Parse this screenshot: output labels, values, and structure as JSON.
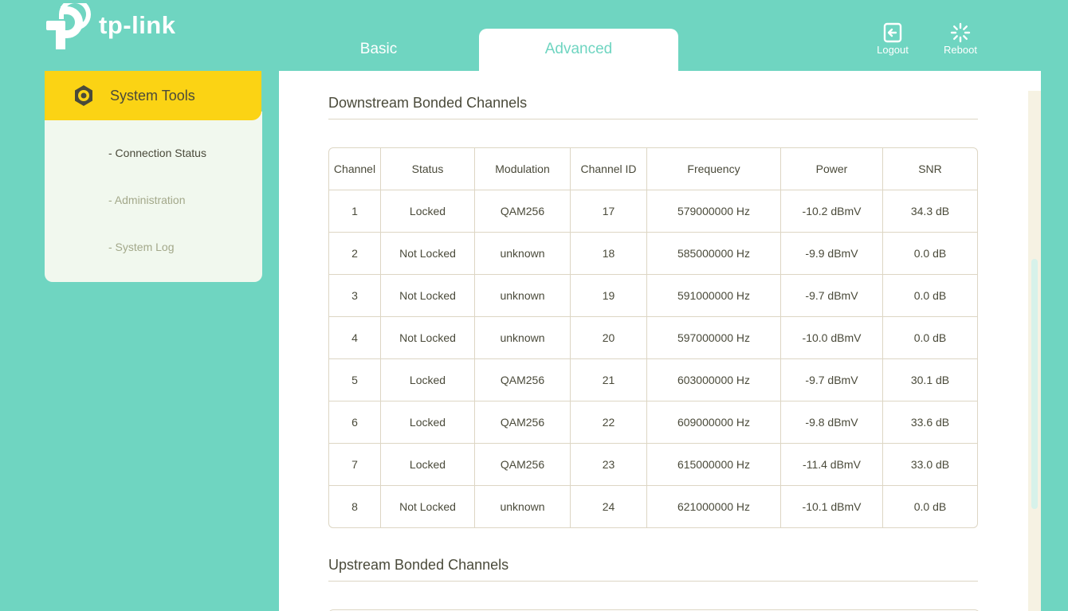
{
  "brand": {
    "logo_text": "tp-link"
  },
  "nav": {
    "tabs": [
      {
        "label": "Basic"
      },
      {
        "label": "Advanced"
      }
    ]
  },
  "actions": {
    "logout": "Logout",
    "reboot": "Reboot"
  },
  "sidebar": {
    "section": "System Tools",
    "items": [
      {
        "label": "- Connection Status"
      },
      {
        "label": "- Administration"
      },
      {
        "label": "- System Log"
      }
    ]
  },
  "main": {
    "downstream": {
      "title": "Downstream Bonded Channels",
      "columns": [
        "Channel",
        "Status",
        "Modulation",
        "Channel ID",
        "Frequency",
        "Power",
        "SNR"
      ],
      "rows": [
        [
          "1",
          "Locked",
          "QAM256",
          "17",
          "579000000 Hz",
          "-10.2 dBmV",
          "34.3 dB"
        ],
        [
          "2",
          "Not Locked",
          "unknown",
          "18",
          "585000000 Hz",
          "-9.9 dBmV",
          "0.0 dB"
        ],
        [
          "3",
          "Not Locked",
          "unknown",
          "19",
          "591000000 Hz",
          "-9.7 dBmV",
          "0.0 dB"
        ],
        [
          "4",
          "Not Locked",
          "unknown",
          "20",
          "597000000 Hz",
          "-10.0 dBmV",
          "0.0 dB"
        ],
        [
          "5",
          "Locked",
          "QAM256",
          "21",
          "603000000 Hz",
          "-9.7 dBmV",
          "30.1 dB"
        ],
        [
          "6",
          "Locked",
          "QAM256",
          "22",
          "609000000 Hz",
          "-9.8 dBmV",
          "33.6 dB"
        ],
        [
          "7",
          "Locked",
          "QAM256",
          "23",
          "615000000 Hz",
          "-11.4 dBmV",
          "33.0 dB"
        ],
        [
          "8",
          "Not Locked",
          "unknown",
          "24",
          "621000000 Hz",
          "-10.1 dBmV",
          "0.0 dB"
        ]
      ]
    },
    "upstream": {
      "title": "Upstream Bonded Channels"
    }
  },
  "colors": {
    "brand": "#6fd5c1",
    "accent": "#fbd314",
    "sidebar_bg": "#f1f8ee"
  }
}
